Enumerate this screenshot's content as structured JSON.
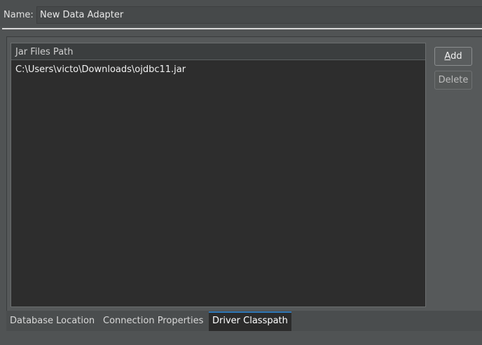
{
  "name_field": {
    "label": "Name:",
    "value": "New Data Adapter"
  },
  "jar_table": {
    "header": "Jar Files Path",
    "rows": [
      "C:\\Users\\victo\\Downloads\\ojdbc11.jar"
    ]
  },
  "buttons": {
    "add_prefix": "A",
    "add_rest": "dd",
    "delete": "Delete"
  },
  "tabs": [
    {
      "label": "Database Location"
    },
    {
      "label": "Connection Properties"
    },
    {
      "label": "Driver Classpath"
    }
  ],
  "colors": {
    "background": "#505354",
    "table_background": "#2d2d2d",
    "active_tab_accent": "#2f78b8"
  }
}
